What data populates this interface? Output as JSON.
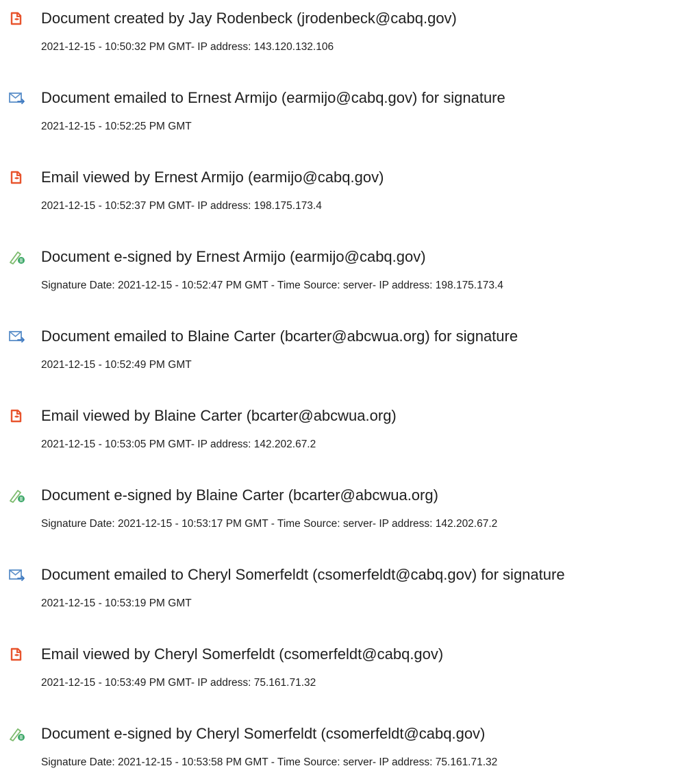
{
  "events": [
    {
      "icon": "document-view-icon",
      "title": "Document created by Jay Rodenbeck (jrodenbeck@cabq.gov)",
      "detail": "2021-12-15 - 10:50:32 PM GMT- IP address: 143.120.132.106"
    },
    {
      "icon": "email-sent-icon",
      "title": "Document emailed to Ernest Armijo (earmijo@cabq.gov) for signature",
      "detail": "2021-12-15 - 10:52:25 PM GMT"
    },
    {
      "icon": "document-view-icon",
      "title": "Email viewed by Ernest Armijo (earmijo@cabq.gov)",
      "detail": "2021-12-15 - 10:52:37 PM GMT- IP address: 198.175.173.4"
    },
    {
      "icon": "e-sign-pen-icon",
      "title": "Document e-signed by Ernest Armijo (earmijo@cabq.gov)",
      "detail": "Signature Date: 2021-12-15 - 10:52:47 PM GMT - Time Source: server- IP address: 198.175.173.4"
    },
    {
      "icon": "email-sent-icon",
      "title": "Document emailed to Blaine Carter (bcarter@abcwua.org) for signature",
      "detail": "2021-12-15 - 10:52:49 PM GMT"
    },
    {
      "icon": "document-view-icon",
      "title": "Email viewed by Blaine Carter (bcarter@abcwua.org)",
      "detail": "2021-12-15 - 10:53:05 PM GMT- IP address: 142.202.67.2"
    },
    {
      "icon": "e-sign-pen-icon",
      "title": "Document e-signed by Blaine Carter (bcarter@abcwua.org)",
      "detail": "Signature Date: 2021-12-15 - 10:53:17 PM GMT - Time Source: server- IP address: 142.202.67.2"
    },
    {
      "icon": "email-sent-icon",
      "title": "Document emailed to Cheryl Somerfeldt (csomerfeldt@cabq.gov) for signature",
      "detail": "2021-12-15 - 10:53:19 PM GMT"
    },
    {
      "icon": "document-view-icon",
      "title": "Email viewed by Cheryl Somerfeldt (csomerfeldt@cabq.gov)",
      "detail": "2021-12-15 - 10:53:49 PM GMT- IP address: 75.161.71.32"
    },
    {
      "icon": "e-sign-pen-icon",
      "title": "Document e-signed by Cheryl Somerfeldt (csomerfeldt@cabq.gov)",
      "detail": "Signature Date: 2021-12-15 - 10:53:58 PM GMT - Time Source: server- IP address: 75.161.71.32"
    }
  ],
  "colors": {
    "doc_icon": "#e8542d",
    "email_icon": "#5b8fc9",
    "email_arrow": "#3c78c0",
    "pen_icon": "#7dbb6e",
    "pen_badge": "#3fa86a",
    "text": "#1e1e1e"
  }
}
